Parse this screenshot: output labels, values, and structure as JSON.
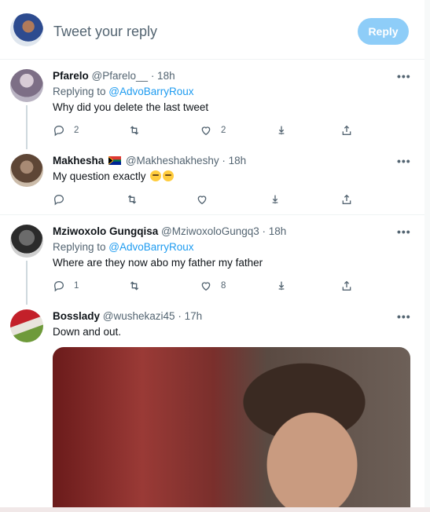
{
  "reply": {
    "placeholder": "Tweet your reply",
    "button_label": "Reply"
  },
  "tweets": [
    {
      "name": "Pfarelo",
      "handle": "@Pfarelo__",
      "time": "· 18h",
      "replying_to_prefix": "Replying to ",
      "replying_to": "@AdvoBarryRoux",
      "text": "Why did you delete the last tweet",
      "replies": "2",
      "retweets": "",
      "likes": "2"
    },
    {
      "name": "Makhesha",
      "handle": "@Makheshakheshy",
      "time": "· 18h",
      "text": "My question exactly",
      "emoji": "thinking-face-emoji",
      "flag": "south-africa-flag",
      "replies": "",
      "retweets": "",
      "likes": ""
    },
    {
      "name": "Mziwoxolo Gungqisa",
      "handle": "@MziwoxoloGungq3",
      "time": "· 18h",
      "replying_to_prefix": "Replying to ",
      "replying_to": "@AdvoBarryRoux",
      "text": "Where are they now abo my father my father",
      "replies": "1",
      "retweets": "",
      "likes": "8"
    },
    {
      "name": "Bosslady",
      "handle": "@wushekazi45",
      "time": "· 17h",
      "text": "Down and out.",
      "replies": "",
      "retweets": "",
      "likes": ""
    }
  ],
  "more_label": "•••",
  "colors": {
    "accent": "#1d9bf0",
    "reply_button_disabled": "#8ecdf8",
    "muted": "#536471"
  },
  "icons": [
    "reply-icon",
    "retweet-icon",
    "like-icon",
    "download-icon",
    "share-icon",
    "more-icon"
  ]
}
